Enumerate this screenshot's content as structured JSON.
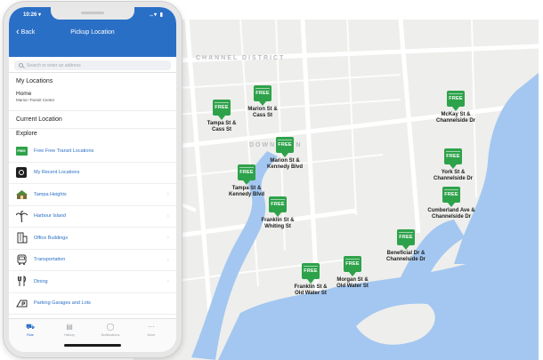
{
  "status_bar": {
    "time": "10:26 ▾",
    "signal": "‥▾ ▮"
  },
  "nav": {
    "back_label": "Back",
    "title": "Pickup Location"
  },
  "search": {
    "placeholder": "Search or enter an address"
  },
  "my_locations": {
    "heading": "My Locations",
    "home_title": "Home",
    "home_subtitle": "Marion Transit Center"
  },
  "current_location": "Current Location",
  "explore": {
    "heading": "Explore",
    "items": [
      {
        "label": "Free Free Transit Locations",
        "icon": "free-badge-icon"
      },
      {
        "label": "My Recent Locations",
        "icon": "recent-icon"
      },
      {
        "label": "Tampa Heights",
        "icon": "neighborhood-icon"
      },
      {
        "label": "Harbour Island",
        "icon": "palm-tree-icon"
      },
      {
        "label": "Office Buildings",
        "icon": "office-building-icon"
      },
      {
        "label": "Transportation",
        "icon": "bus-icon"
      },
      {
        "label": "Dining",
        "icon": "fork-knife-icon"
      },
      {
        "label": "Parking Garages and Lots",
        "icon": "parking-icon"
      }
    ]
  },
  "tabs": [
    {
      "label": "Ride",
      "icon": "car-icon",
      "active": true
    },
    {
      "label": "History",
      "icon": "history-icon",
      "active": false
    },
    {
      "label": "Notifications",
      "icon": "bell-icon",
      "active": false
    },
    {
      "label": "More",
      "icon": "more-icon",
      "active": false
    }
  ],
  "map": {
    "badge_text": "FREE",
    "area_labels": [
      "CHANNEL DISTRICT",
      "DOWNTOWN"
    ],
    "stops": [
      {
        "line1": "Tampa St &",
        "line2": "Cass St"
      },
      {
        "line1": "Marion St &",
        "line2": "Cass St"
      },
      {
        "line1": "Marion St &",
        "line2": "Kennedy Blvd"
      },
      {
        "line1": "Tampa St &",
        "line2": "Kennedy Blvd"
      },
      {
        "line1": "Franklin St &",
        "line2": "Whiting St"
      },
      {
        "line1": "McKay St &",
        "line2": "Channelside Dr"
      },
      {
        "line1": "York St &",
        "line2": "Channelside Dr"
      },
      {
        "line1": "Cumberland Ave &",
        "line2": "Channelside Dr"
      },
      {
        "line1": "Beneficial Dr &",
        "line2": "Channelside Dr"
      },
      {
        "line1": "Morgan St &",
        "line2": "Old Water St"
      },
      {
        "line1": "Franklin St &",
        "line2": "Old Water St"
      }
    ]
  },
  "colors": {
    "header_blue": "#2a6fc6",
    "free_green": "#2ea24a",
    "water": "#a3c7f0"
  }
}
